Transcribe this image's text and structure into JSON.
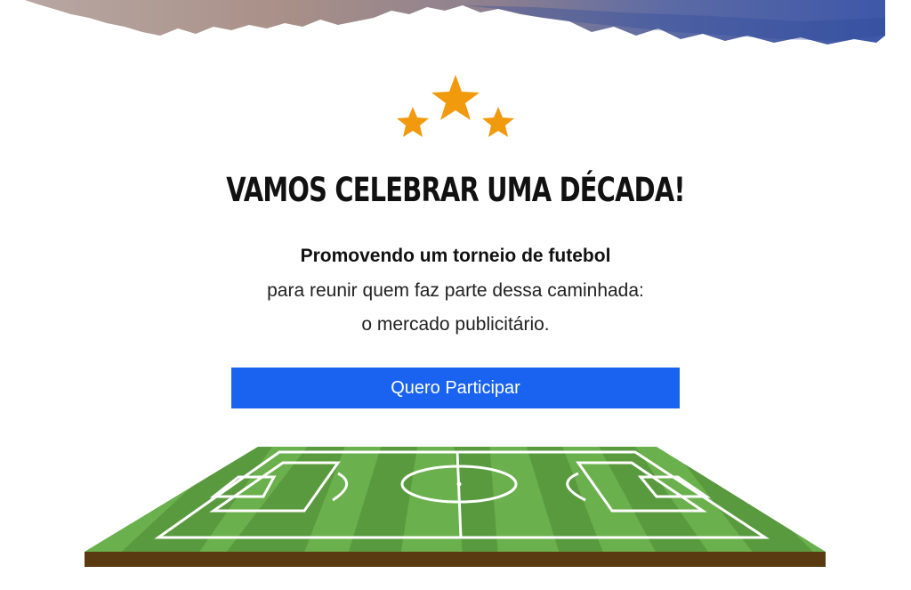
{
  "hero": {
    "headline": "VAMOS CELEBRAR UMA DÉCADA!",
    "lead": "Promovendo um torneio de futebol",
    "line_1": "para reunir quem faz parte dessa caminhada:",
    "line_2": "o mercado publicitário."
  },
  "cta": {
    "label": "Quero Participar"
  },
  "colors": {
    "star": "#f29a0e",
    "cta_bg": "#1a63f0",
    "grass_light": "#6ab04c",
    "grass_dark": "#5a9a3f",
    "soil": "#5a3a10"
  },
  "icons": {
    "stars": "three-stars-icon",
    "pitch": "soccer-field-illustration"
  }
}
